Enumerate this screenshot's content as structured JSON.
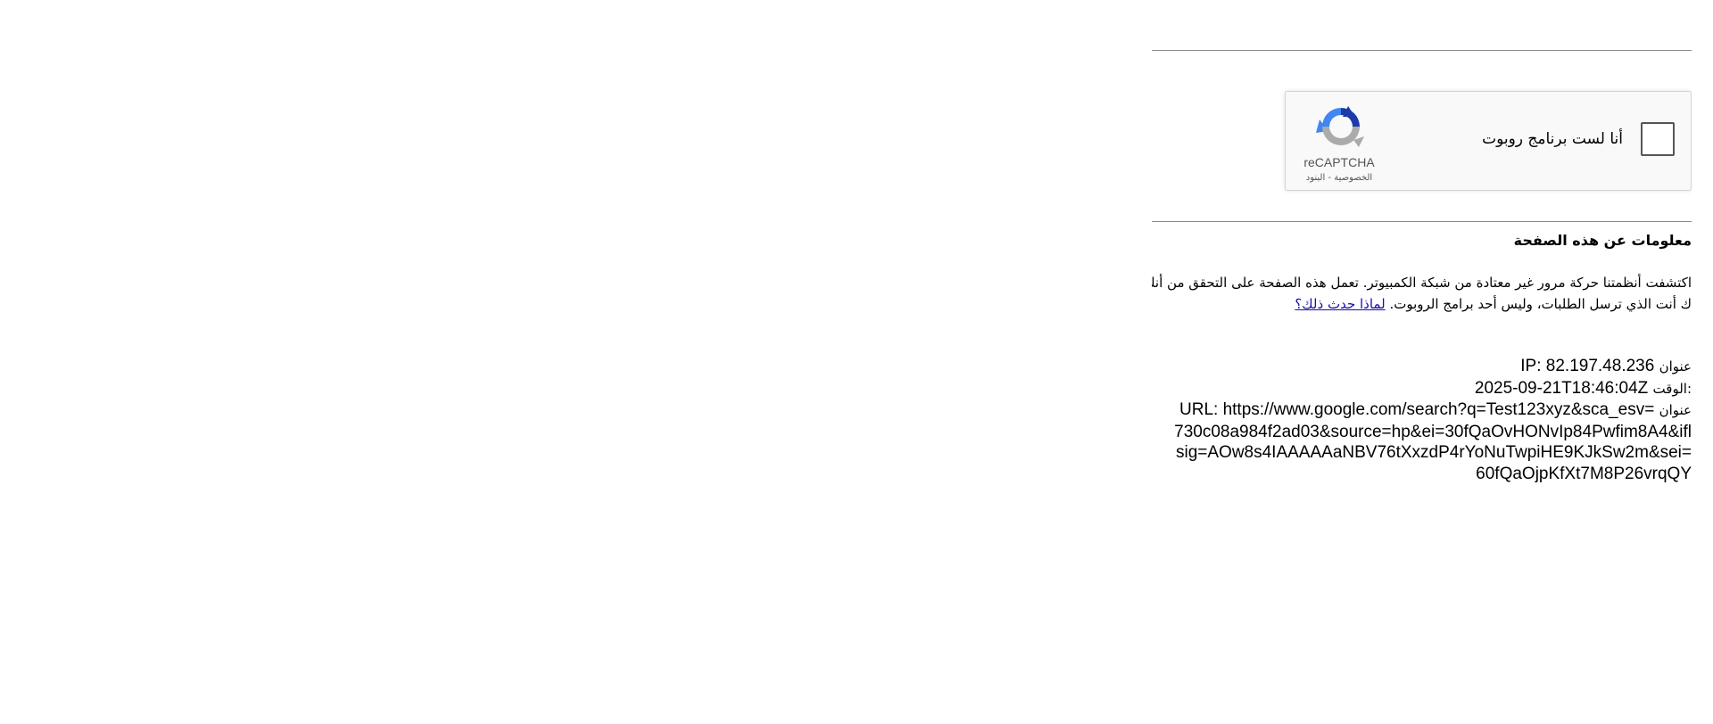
{
  "recaptcha": {
    "checkbox_label": "أنا لست برنامج روبوت",
    "brand": "reCAPTCHA",
    "privacy_link": "الخصوصية",
    "separator": " - ",
    "terms_link": "البنود",
    "colors": {
      "logo_blue_dark": "#1c3aa9",
      "logo_blue": "#4285f4",
      "logo_gray": "#ababab"
    }
  },
  "about": {
    "heading": "معلومات عن هذه الصفحة",
    "line1": "اكتشفت أنظمتنا حركة مرور غير معتادة من شبكة الكمبيوتر. تعمل هذه الصفحة على التحقق من أنك",
    "line2": "ك أنت الذي ترسل الطلبات، وليس أحد برامج الروبوت.",
    "why_link": "لماذا حدث ذلك؟"
  },
  "info": {
    "ip_label": "عنوان",
    "ip_value": "IP: 82.197.48.236",
    "time_label": "الوقت:",
    "time_value": "2025-09-21T18:46:04Z",
    "url_label": "عنوان",
    "url_lines": [
      "URL: https://www.google.com/search?q=Test123xyz&sca_esv=",
      "730c08a984f2ad03&source=hp&ei=30fQaOvHONvIp84Pwfim8A4&ifl",
      "sig=AOw8s4IAAAAAaNBV76tXxzdP4rYoNuTwpiHE9KJkSw2m&sei=",
      "60fQaOjpKfXt7M8P26vrqQY"
    ]
  }
}
